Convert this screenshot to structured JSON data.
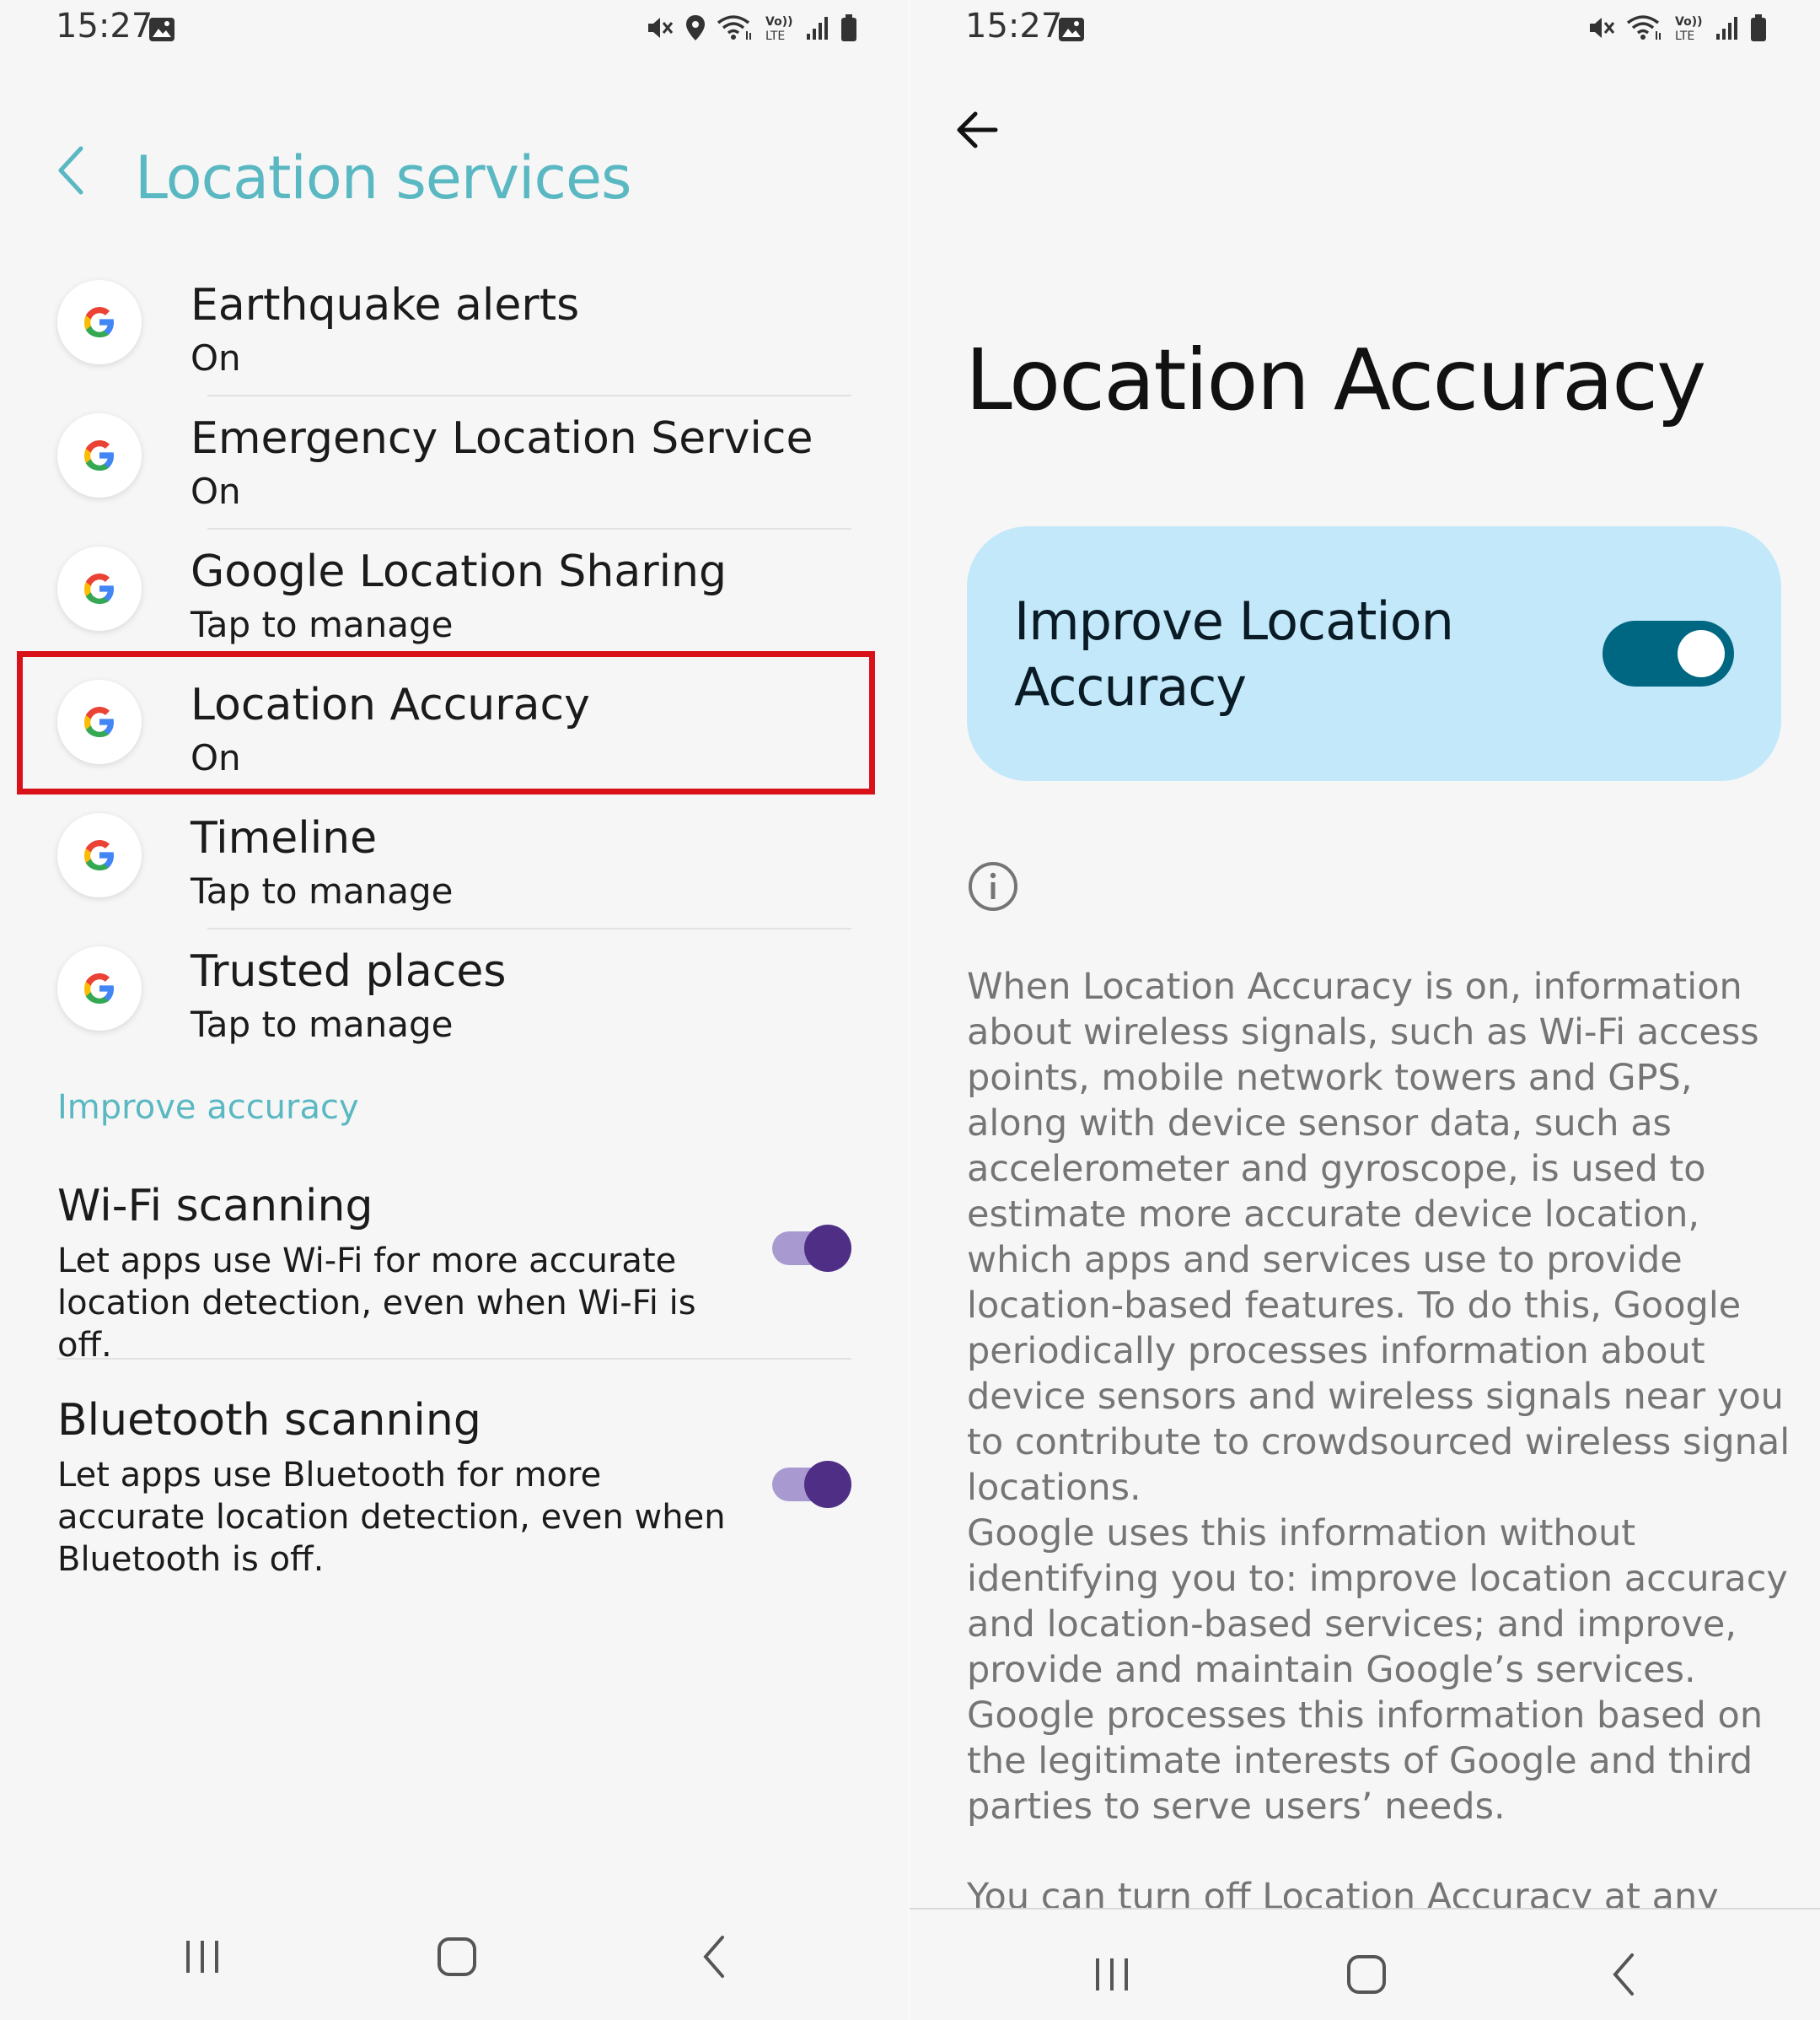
{
  "left": {
    "status_time": "15:27",
    "title": "Location services",
    "items": [
      {
        "title": "Earthquake alerts",
        "sub": "On"
      },
      {
        "title": "Emergency Location Service",
        "sub": "On"
      },
      {
        "title": "Google Location Sharing",
        "sub": "Tap to manage"
      },
      {
        "title": "Location Accuracy",
        "sub": "On"
      },
      {
        "title": "Timeline",
        "sub": "Tap to manage"
      },
      {
        "title": "Trusted places",
        "sub": "Tap to manage"
      }
    ],
    "section": "Improve accuracy",
    "wifi": {
      "title": "Wi-Fi scanning",
      "desc": "Let apps use Wi-Fi for more accurate location detection, even when Wi-Fi is off.",
      "enabled": true
    },
    "bluetooth": {
      "title": "Bluetooth scanning",
      "desc": "Let apps use Bluetooth for more accurate location detection, even when Bluetooth is off.",
      "enabled": true
    }
  },
  "right": {
    "status_time": "15:27",
    "title": "Location Accuracy",
    "toggle_label": "Improve Location Accuracy",
    "toggle_enabled": true,
    "para1": "When Location Accuracy is on, information about wireless signals, such as Wi-Fi access points, mobile network towers and GPS, along with device sensor data, such as accelerometer and gyroscope, is used to estimate more accurate device location, which apps and services use to provide location-based features. To do this, Google periodically processes information about device sensors and wireless signals near you to contribute to crowdsourced wireless signal locations.",
    "para2": "Google uses this information without identifying you to: improve location accuracy and location-based services; and improve, provide and maintain Google’s services. Google processes this information based on the legitimate interests of Google and third parties to serve users’ needs.",
    "para3": "You can turn off Location Accuracy at any time"
  },
  "colors": {
    "accent_teal": "#5ab8c2",
    "highlight_red": "#d9121a",
    "toggle_purple": "#4f2f86",
    "card_blue": "#c2e8fa",
    "toggle_blue": "#006782"
  },
  "icons": [
    "image-icon",
    "mute-icon",
    "location-pin-icon",
    "wifi-icon",
    "volte-icon",
    "signal-icon",
    "battery-icon",
    "back-chevron-icon",
    "google-g-icon",
    "info-icon",
    "recents-icon",
    "home-icon",
    "back-icon"
  ]
}
